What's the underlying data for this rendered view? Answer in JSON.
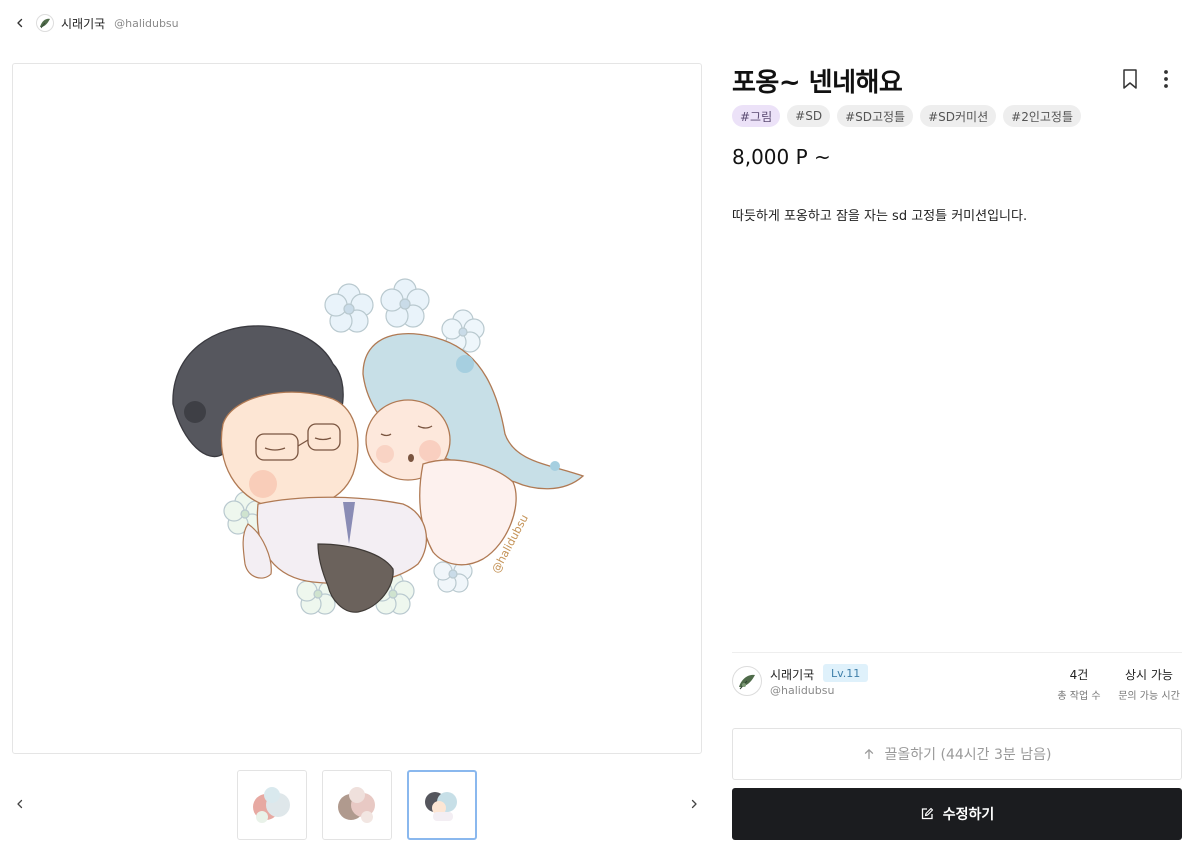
{
  "header": {
    "shop_name": "시래기국",
    "handle": "@halidubsu"
  },
  "product": {
    "title": "포옹~ 넨네해요",
    "tags": [
      "#그림",
      "#SD",
      "#SD고정틀",
      "#SD커미션",
      "#2인고정틀"
    ],
    "price": "8,000 P ~",
    "description": "따듯하게 포옹하고 잠을 자는 sd 고정틀 커미션입니다.",
    "artwork_signature": "@halidubsu"
  },
  "gallery": {
    "thumbnail_count": 3,
    "selected_index": 2
  },
  "seller": {
    "name": "시래기국",
    "level": "Lv.11",
    "handle": "@halidubsu",
    "works_value": "4건",
    "works_label": "총 작업 수",
    "inquiry_value": "상시 가능",
    "inquiry_label": "문의 가능 시간"
  },
  "actions": {
    "bump_label": "끌올하기 (44시간 3분 남음)",
    "edit_label": "수정하기"
  },
  "colors": {
    "tag_highlight_bg": "#ece2f8",
    "tag_bg": "#eeeeee",
    "level_bg": "#dff1fb",
    "primary_button": "#1b1c1f",
    "selected_thumb_border": "#8ab8ee"
  },
  "icons": {
    "back": "chevron-left-icon",
    "bookmark": "bookmark-icon",
    "more": "more-vertical-icon",
    "prev": "chevron-left-icon",
    "next": "chevron-right-icon",
    "bump": "arrow-up-icon",
    "edit": "edit-icon"
  }
}
